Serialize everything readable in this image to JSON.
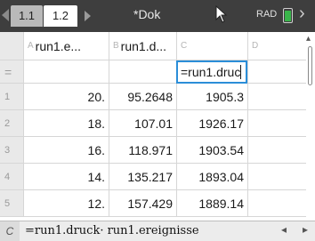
{
  "tabs": [
    {
      "label": "1.1"
    },
    {
      "label": "1.2"
    }
  ],
  "document": {
    "title": "*Dok"
  },
  "status": {
    "angle_mode": "RAD"
  },
  "columns": [
    {
      "letter": "A",
      "name": "run1.e..."
    },
    {
      "letter": "B",
      "name": "run1.d..."
    },
    {
      "letter": "C",
      "name": ""
    },
    {
      "letter": "D",
      "name": ""
    }
  ],
  "formula_row": {
    "marker": "=",
    "active_cell_text": "=run1.druc"
  },
  "rows": [
    {
      "num": "1",
      "a": "20.",
      "b": "95.2648",
      "c": "1905.3"
    },
    {
      "num": "2",
      "a": "18.",
      "b": "107.01",
      "c": "1926.17"
    },
    {
      "num": "3",
      "a": "16.",
      "b": "118.971",
      "c": "1903.54"
    },
    {
      "num": "4",
      "a": "14.",
      "b": "135.217",
      "c": "1893.04"
    },
    {
      "num": "5",
      "a": "12.",
      "b": "157.429",
      "c": "1889.14"
    }
  ],
  "entry_line": {
    "cell_ref": "C",
    "expression": "=run1.druck· run1.ereignisse"
  },
  "icons": {
    "tab_prev": "chevron-left-icon",
    "tab_next": "chevron-right-icon",
    "cursor": "mouse-pointer-icon",
    "battery": "battery-icon",
    "close": "close-icon"
  },
  "colors": {
    "topbar": "#3e3e3e",
    "active_cell_border": "#2b8ed8",
    "battery_fill": "#39b54a"
  }
}
